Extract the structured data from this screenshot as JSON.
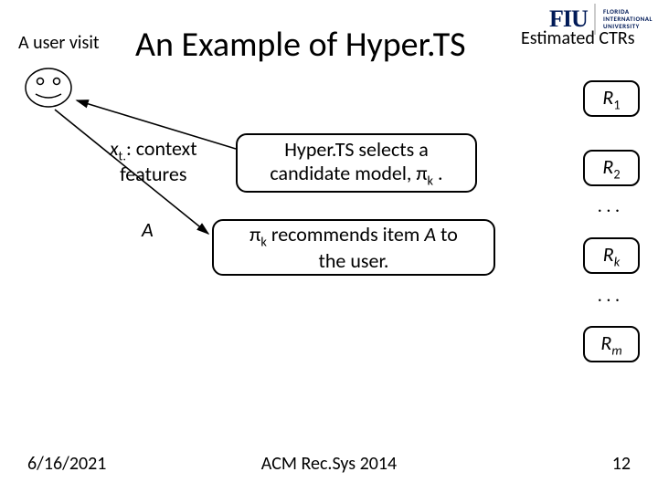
{
  "header": {
    "user_visit": "A user visit",
    "title": "An Example of Hyper.TS",
    "estimated_ctrs": "Estimated CTRs"
  },
  "logo": {
    "name": "FIU",
    "subtitle_line1": "FLORIDA",
    "subtitle_line2": "INTERNATIONAL",
    "subtitle_line3": "UNIVERSITY"
  },
  "labels": {
    "context_pre": "x",
    "context_sub": "t.",
    "context_post": ": context",
    "features": "features",
    "a": "A"
  },
  "box1": {
    "line1": "Hyper.TS selects a",
    "line2_pre": "candidate model, π",
    "line2_sub": "k",
    "line2_post": " ."
  },
  "box2": {
    "line1_pre": "π",
    "line1_sub": "k",
    "line1_post": " recommends item ",
    "line1_item": "A",
    "line1_end": " to",
    "line2": "the user."
  },
  "rboxes": {
    "r1_base": "R",
    "r1_sub": "1",
    "r2_base": "R",
    "r2_sub": "2",
    "rk_base": "R",
    "rk_sub": "k",
    "rm_base": "R",
    "rm_sub": "m"
  },
  "dots": ". . .",
  "footer": {
    "date": "6/16/2021",
    "center": "ACM Rec.Sys 2014",
    "page": "12"
  }
}
